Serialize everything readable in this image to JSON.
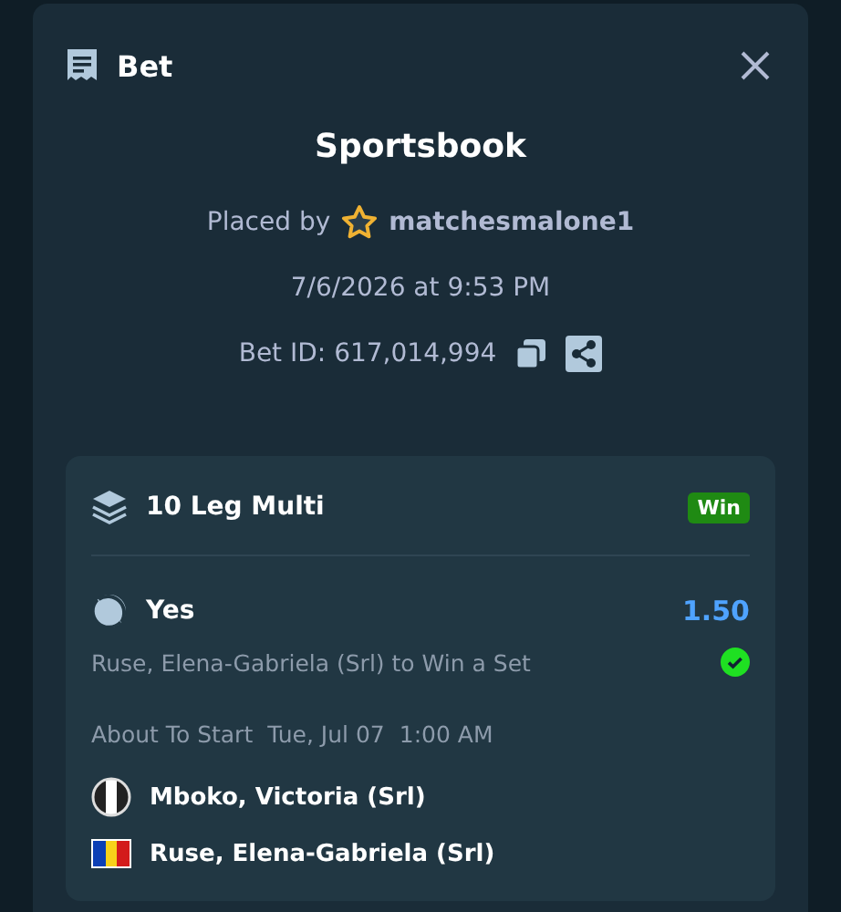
{
  "dialog": {
    "title": "Bet"
  },
  "source": "Sportsbook",
  "placed_by": {
    "label": "Placed by",
    "user": "matchesmalone1"
  },
  "placed_at": "7/6/2026 at 9:53 PM",
  "bet_id": "Bet ID: 617,014,994",
  "bet": {
    "title": "10 Leg Multi",
    "status": "Win",
    "leg": {
      "selection": "Yes",
      "odds": "1.50",
      "market": "Ruse, Elena-Gabriela (Srl) to Win a Set",
      "won": true,
      "status": "About To Start",
      "date": "Tue, Jul 07",
      "time": "1:00 AM",
      "players": [
        {
          "name": "Mboko, Victoria (Srl)"
        },
        {
          "name": "Ruse, Elena-Gabriela (Srl)"
        }
      ]
    }
  }
}
